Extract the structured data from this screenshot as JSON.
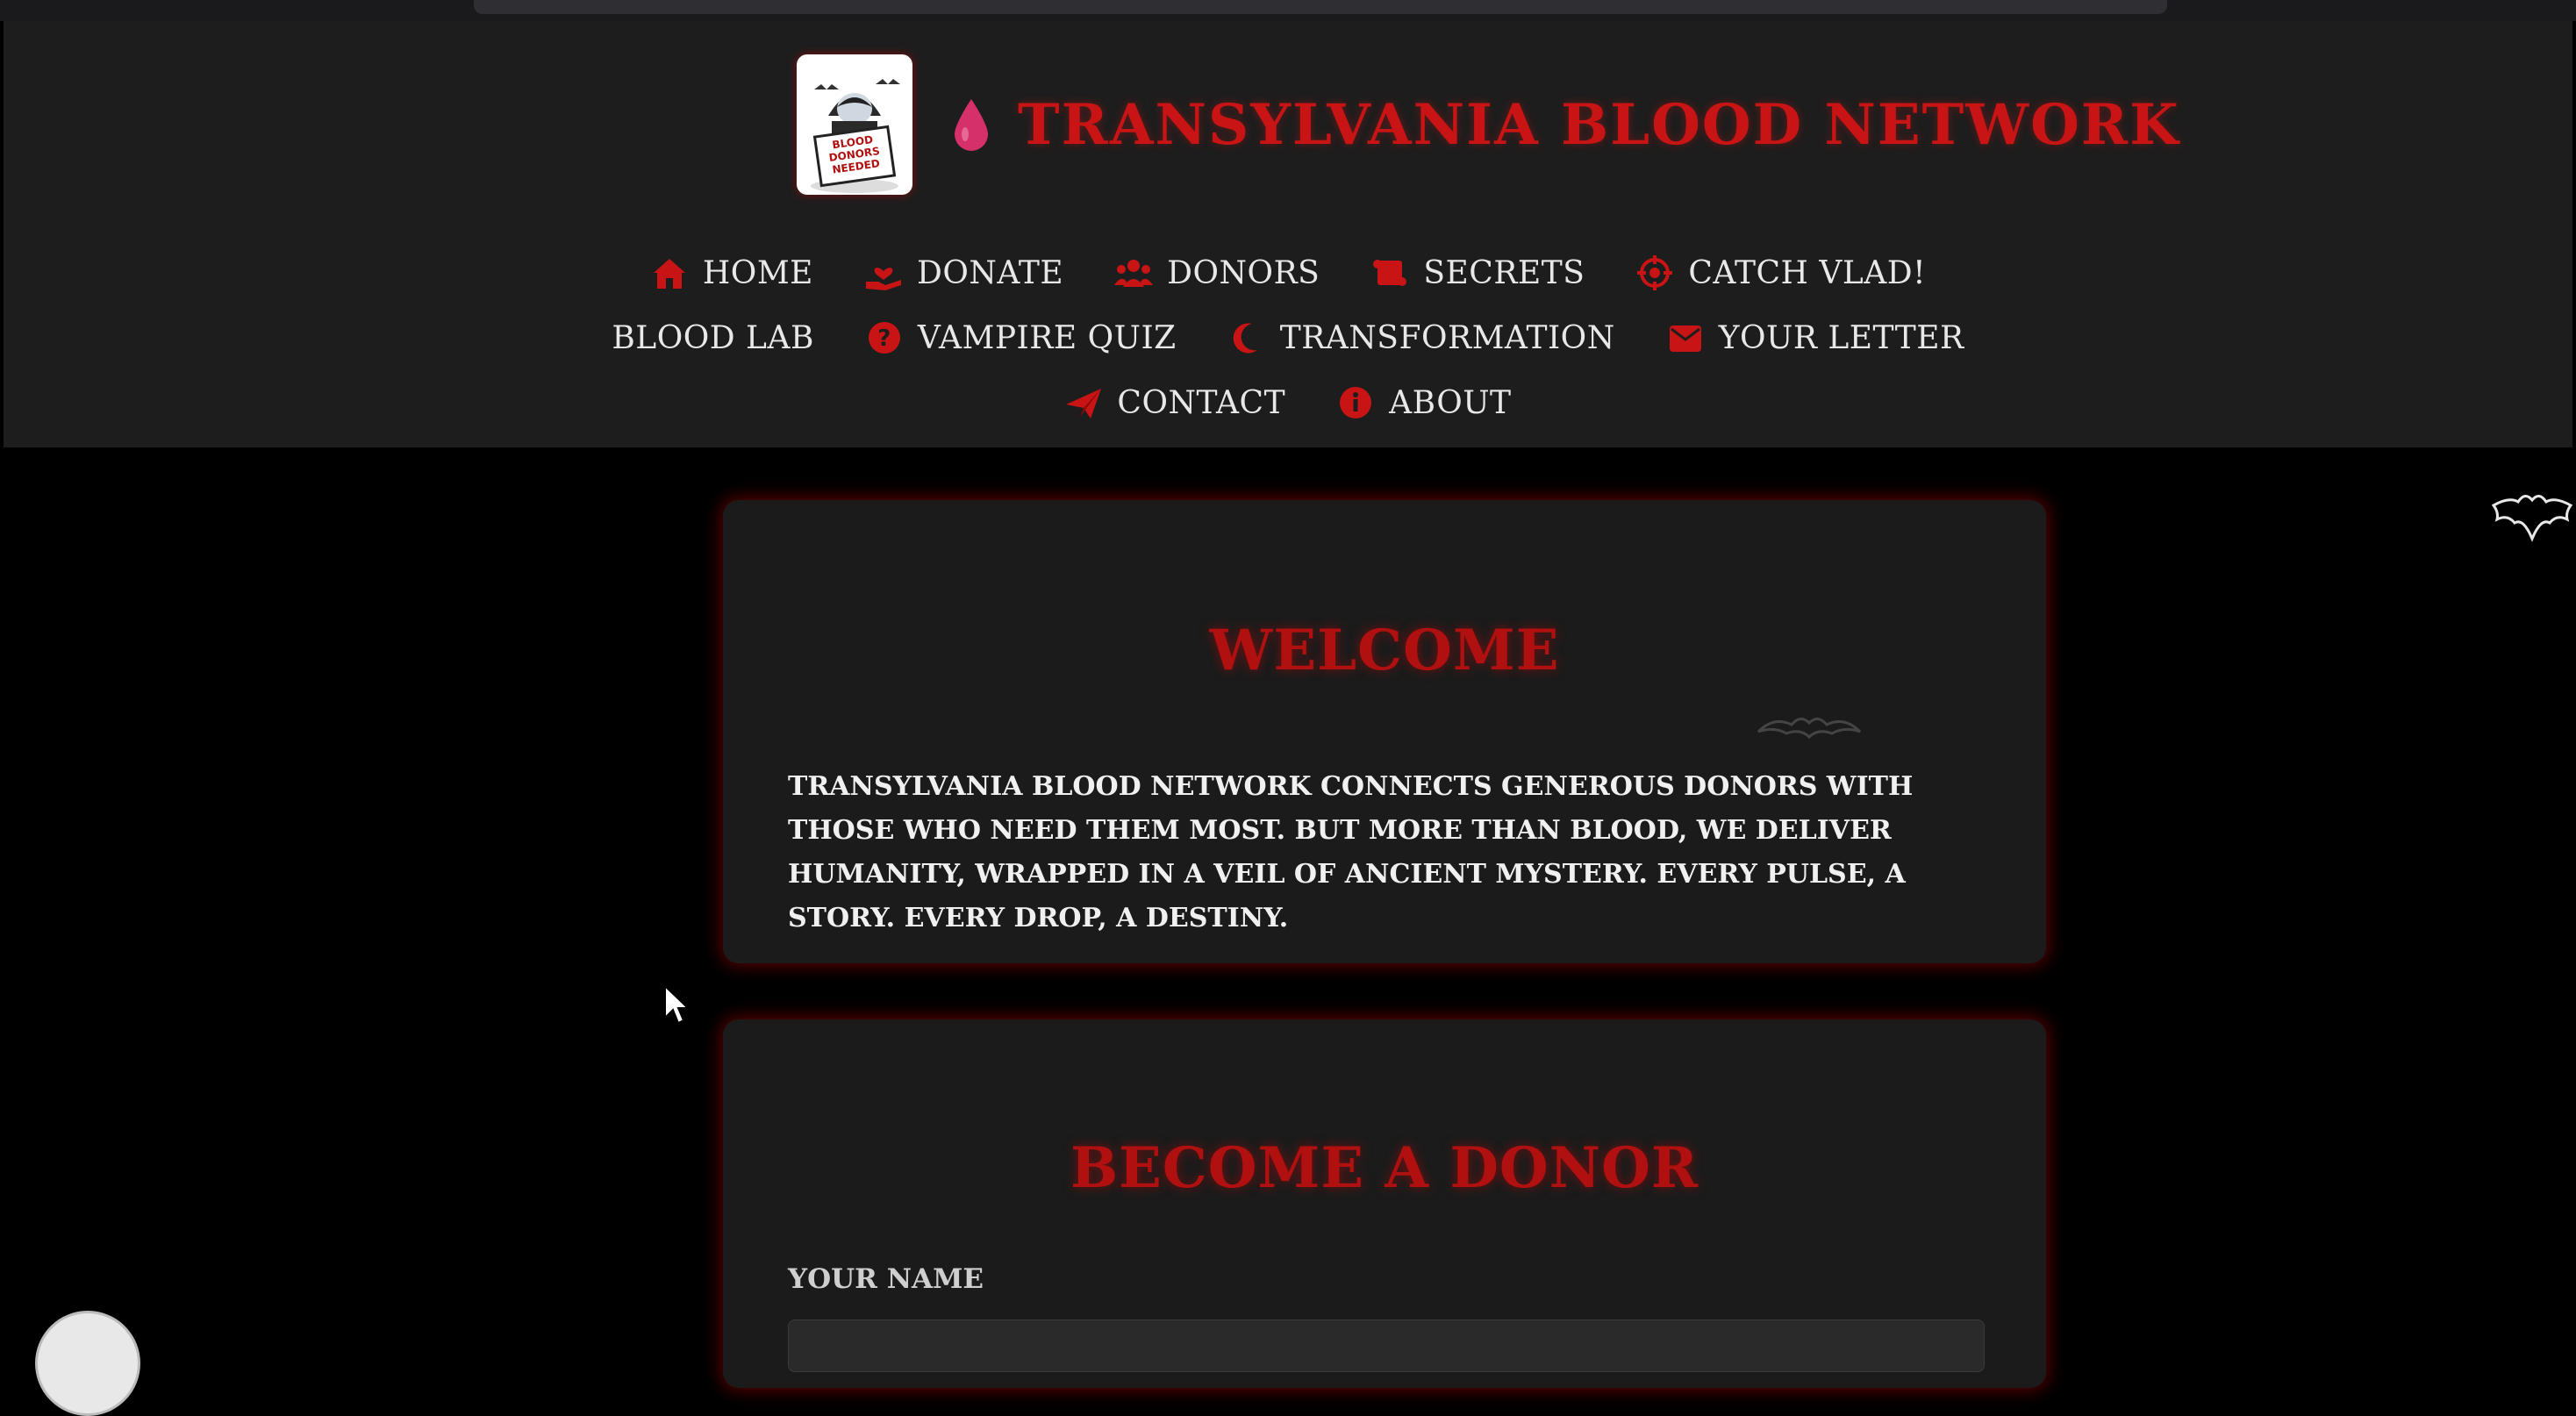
{
  "brand": {
    "title": "Transylvania Blood Network",
    "logo_text": "BLOOD DONORS NEEDED",
    "accent_color": "#c81414"
  },
  "nav": {
    "rows": [
      [
        {
          "label": "Home",
          "icon": "home-icon"
        },
        {
          "label": "Donate",
          "icon": "hand-heart-icon"
        },
        {
          "label": "Donors",
          "icon": "users-icon"
        },
        {
          "label": "Secrets",
          "icon": "scroll-icon"
        },
        {
          "label": "Catch Vlad!",
          "icon": "crosshair-icon"
        }
      ],
      [
        {
          "label": "Blood Lab",
          "icon": ""
        },
        {
          "label": "Vampire Quiz",
          "icon": "question-icon"
        },
        {
          "label": "Transformation",
          "icon": "moon-icon"
        },
        {
          "label": "Your Letter",
          "icon": "envelope-icon"
        }
      ],
      [
        {
          "label": "Contact",
          "icon": "paper-plane-icon"
        },
        {
          "label": "About",
          "icon": "info-icon"
        }
      ]
    ]
  },
  "welcome": {
    "heading": "Welcome",
    "text": "Transylvania Blood Network connects generous donors with those who need them most. But more than blood, we deliver humanity, wrapped in a veil of ancient mystery. Every pulse, a story. Every drop, a destiny."
  },
  "donor_form": {
    "heading": "Become a Donor",
    "name_label": "Your Name",
    "name_value": ""
  }
}
